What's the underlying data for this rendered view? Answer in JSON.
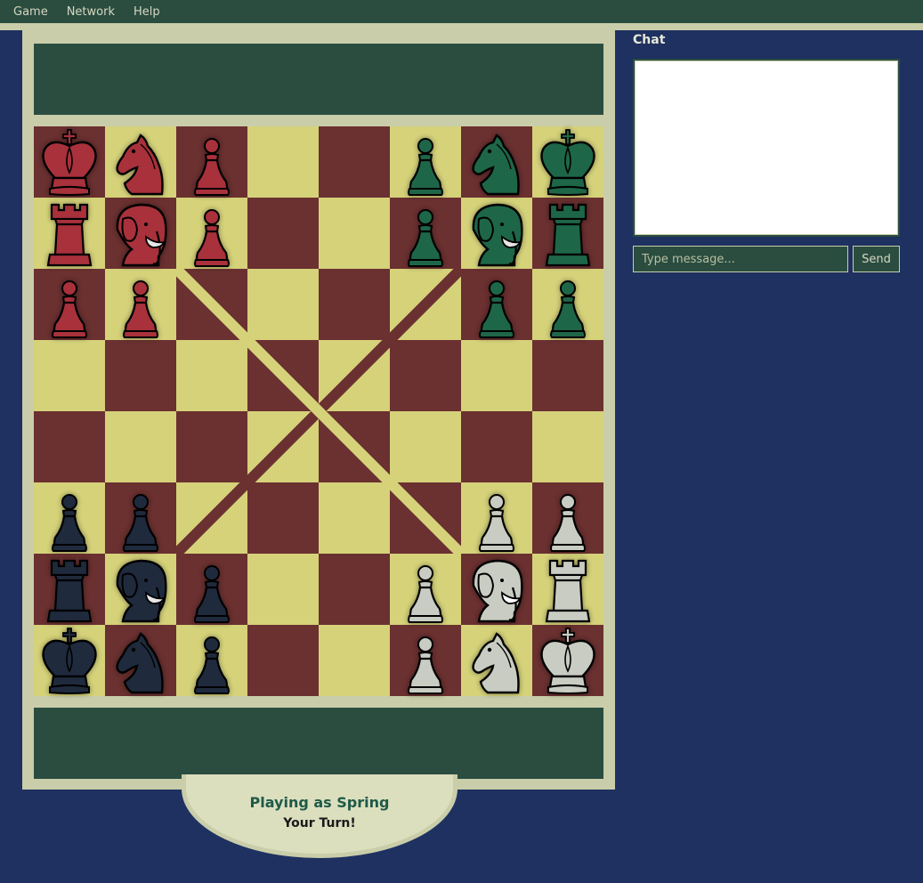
{
  "menu": {
    "items": [
      "Game",
      "Network",
      "Help"
    ]
  },
  "chat": {
    "title": "Chat",
    "placeholder": "Type message...",
    "send_label": "Send",
    "messages": []
  },
  "status": {
    "player": "Playing as Spring",
    "turn": "Your Turn!"
  },
  "colors": {
    "background": "#1e3160",
    "menubar": "#2a4d40",
    "frame": "#c9cda9",
    "tray": "#2a4d40",
    "light_square": "#d5d27a",
    "dark_square": "#6b3030",
    "diagonal_dark": "#6b3030",
    "diagonal_light": "#d5d27a",
    "players": {
      "red": {
        "fill": "#a8313b",
        "detail": "#e6e6e6"
      },
      "green": {
        "fill": "#1e6648",
        "detail": "#e6e6e6"
      },
      "black": {
        "fill": "#1f2a3d",
        "detail": "#e6e6e6"
      },
      "white": {
        "fill": "#c8ccc2",
        "detail": "#ffffff"
      }
    }
  },
  "board": {
    "size": 8,
    "rows": [
      [
        "red-king",
        "red-knight",
        "red-pawn",
        "",
        "",
        "green-pawn",
        "green-knight",
        "green-king"
      ],
      [
        "red-rook",
        "red-elephant",
        "red-pawn",
        "",
        "",
        "green-pawn",
        "green-elephant",
        "green-rook"
      ],
      [
        "red-pawn",
        "red-pawn",
        "",
        "",
        "",
        "",
        "green-pawn",
        "green-pawn"
      ],
      [
        "",
        "",
        "",
        "",
        "",
        "",
        "",
        ""
      ],
      [
        "",
        "",
        "",
        "",
        "",
        "",
        "",
        ""
      ],
      [
        "black-pawn",
        "black-pawn",
        "",
        "",
        "",
        "",
        "white-pawn",
        "white-pawn"
      ],
      [
        "black-rook",
        "black-elephant",
        "black-pawn",
        "",
        "",
        "white-pawn",
        "white-elephant",
        "white-rook"
      ],
      [
        "black-king",
        "black-knight",
        "black-pawn",
        "",
        "",
        "white-pawn",
        "white-knight",
        "white-king"
      ]
    ]
  }
}
